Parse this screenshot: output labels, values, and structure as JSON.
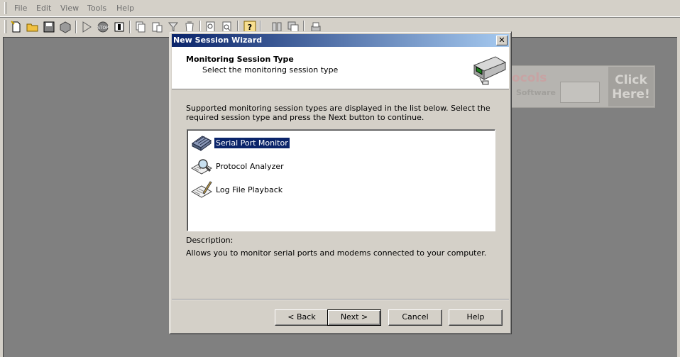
{
  "menu": [
    "File",
    "Edit",
    "View",
    "Tools",
    "Help"
  ],
  "toolbar_icons": [
    "new-icon",
    "open-icon",
    "save-icon",
    "export-icon",
    "play-icon",
    "stop-icon",
    "pause-icon",
    "copy-icon",
    "paste-icon",
    "filter-icon",
    "clear-icon",
    "find-icon",
    "find-next-icon",
    "help-icon",
    "tile-icon",
    "cascade-icon",
    "print-icon"
  ],
  "promo": {
    "text": "ocols",
    "subtext": "Software",
    "click": "Click Here!"
  },
  "dialog": {
    "title": "New Session Wizard",
    "close_glyph": "✕",
    "header_title": "Monitoring Session Type",
    "header_subtitle": "Select the monitoring session type",
    "intro": "Supported monitoring session types are displayed in the list below. Select the required session type and press the Next button to continue.",
    "items": [
      {
        "label": "Serial Port Monitor",
        "icon": "serial-port-icon",
        "selected": true
      },
      {
        "label": "Protocol Analyzer",
        "icon": "protocol-analyzer-icon",
        "selected": false
      },
      {
        "label": "Log File Playback",
        "icon": "log-file-icon",
        "selected": false
      }
    ],
    "description_label": "Description:",
    "description_text": "Allows you to monitor serial ports and modems connected to your computer.",
    "buttons": {
      "back": "< Back",
      "next": "Next >",
      "cancel": "Cancel",
      "help": "Help"
    }
  },
  "colors": {
    "titlebar_start": "#0a246a",
    "titlebar_end": "#a6caf0",
    "selection": "#0a246a",
    "workspace": "#808080"
  }
}
